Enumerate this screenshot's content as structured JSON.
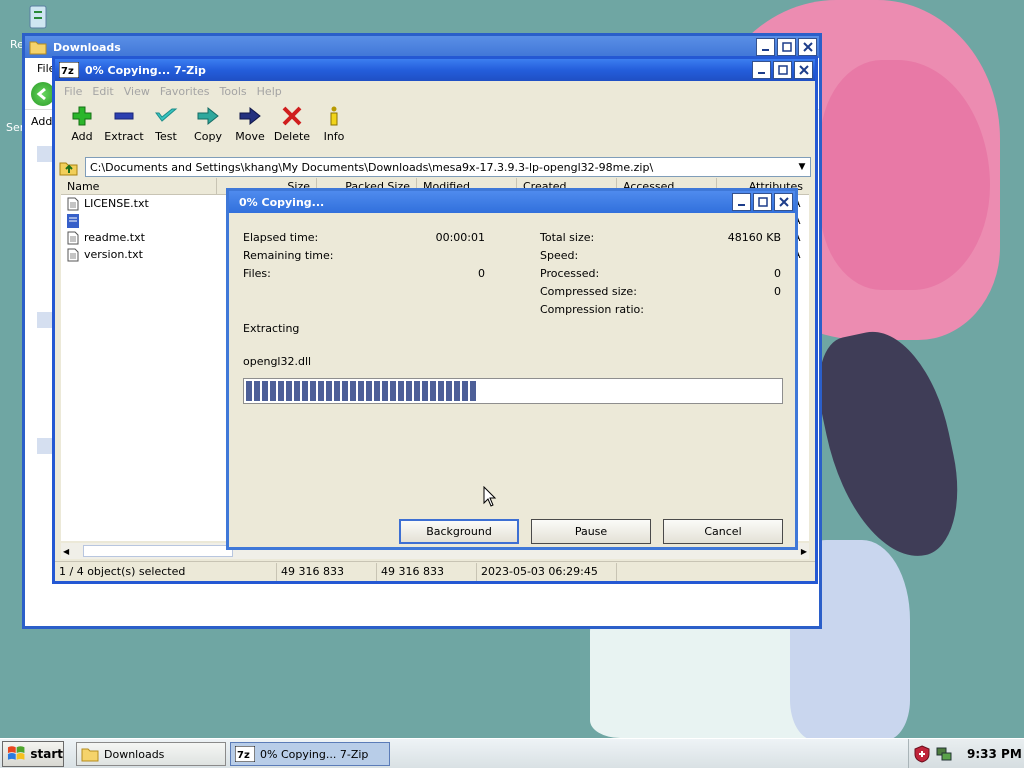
{
  "desktop": {
    "icon_labels": [
      "Re",
      "Ser"
    ]
  },
  "downloads_window": {
    "title": "Downloads",
    "menu": [
      "File"
    ],
    "address_label": "Addr"
  },
  "sevenzip_window": {
    "title": "0% Copying... 7-Zip",
    "menu": [
      "File",
      "Edit",
      "View",
      "Favorites",
      "Tools",
      "Help"
    ],
    "toolbar": [
      {
        "label": "Add",
        "icon": "add-icon"
      },
      {
        "label": "Extract",
        "icon": "extract-icon"
      },
      {
        "label": "Test",
        "icon": "test-icon"
      },
      {
        "label": "Copy",
        "icon": "copy-icon"
      },
      {
        "label": "Move",
        "icon": "move-icon"
      },
      {
        "label": "Delete",
        "icon": "delete-icon"
      },
      {
        "label": "Info",
        "icon": "info-icon"
      }
    ],
    "path": "C:\\Documents and Settings\\khang\\My Documents\\Downloads\\mesa9x-17.3.9.3-lp-opengl32-98me.zip\\",
    "columns": [
      "Name",
      "Size",
      "Packed Size",
      "Modified",
      "Created",
      "Accessed",
      "Attributes"
    ],
    "files": [
      {
        "name": "LICENSE.txt",
        "attr": "A"
      },
      {
        "name": "",
        "attr": "A"
      },
      {
        "name": "readme.txt",
        "attr": "A"
      },
      {
        "name": "version.txt",
        "attr": "A"
      }
    ],
    "status": {
      "selected": "1 / 4 object(s) selected",
      "size": "49 316 833",
      "packed": "49 316 833",
      "date": "2023-05-03 06:29:45"
    }
  },
  "copy_dialog": {
    "title": "0% Copying...",
    "elapsed_label": "Elapsed time:",
    "elapsed_value": "00:00:01",
    "remaining_label": "Remaining time:",
    "files_label": "Files:",
    "files_value": "0",
    "total_size_label": "Total size:",
    "total_size_value": "48160 KB",
    "speed_label": "Speed:",
    "processed_label": "Processed:",
    "processed_value": "0",
    "compressed_label": "Compressed size:",
    "compressed_value": "0",
    "ratio_label": "Compression ratio:",
    "operation": "Extracting",
    "current_file": "opengl32.dll",
    "progress_fraction": 0.43,
    "buttons": {
      "background": "Background",
      "pause": "Pause",
      "cancel": "Cancel"
    }
  },
  "taskbar": {
    "start": "start",
    "items": [
      {
        "label": "Downloads",
        "active": false
      },
      {
        "label": "0% Copying... 7-Zip",
        "active": true
      }
    ],
    "clock": "9:33 PM"
  },
  "colors": {
    "title_blue": "#245edb",
    "progress_fill": "#4d5f98",
    "desktop": "#6fa6a3"
  }
}
